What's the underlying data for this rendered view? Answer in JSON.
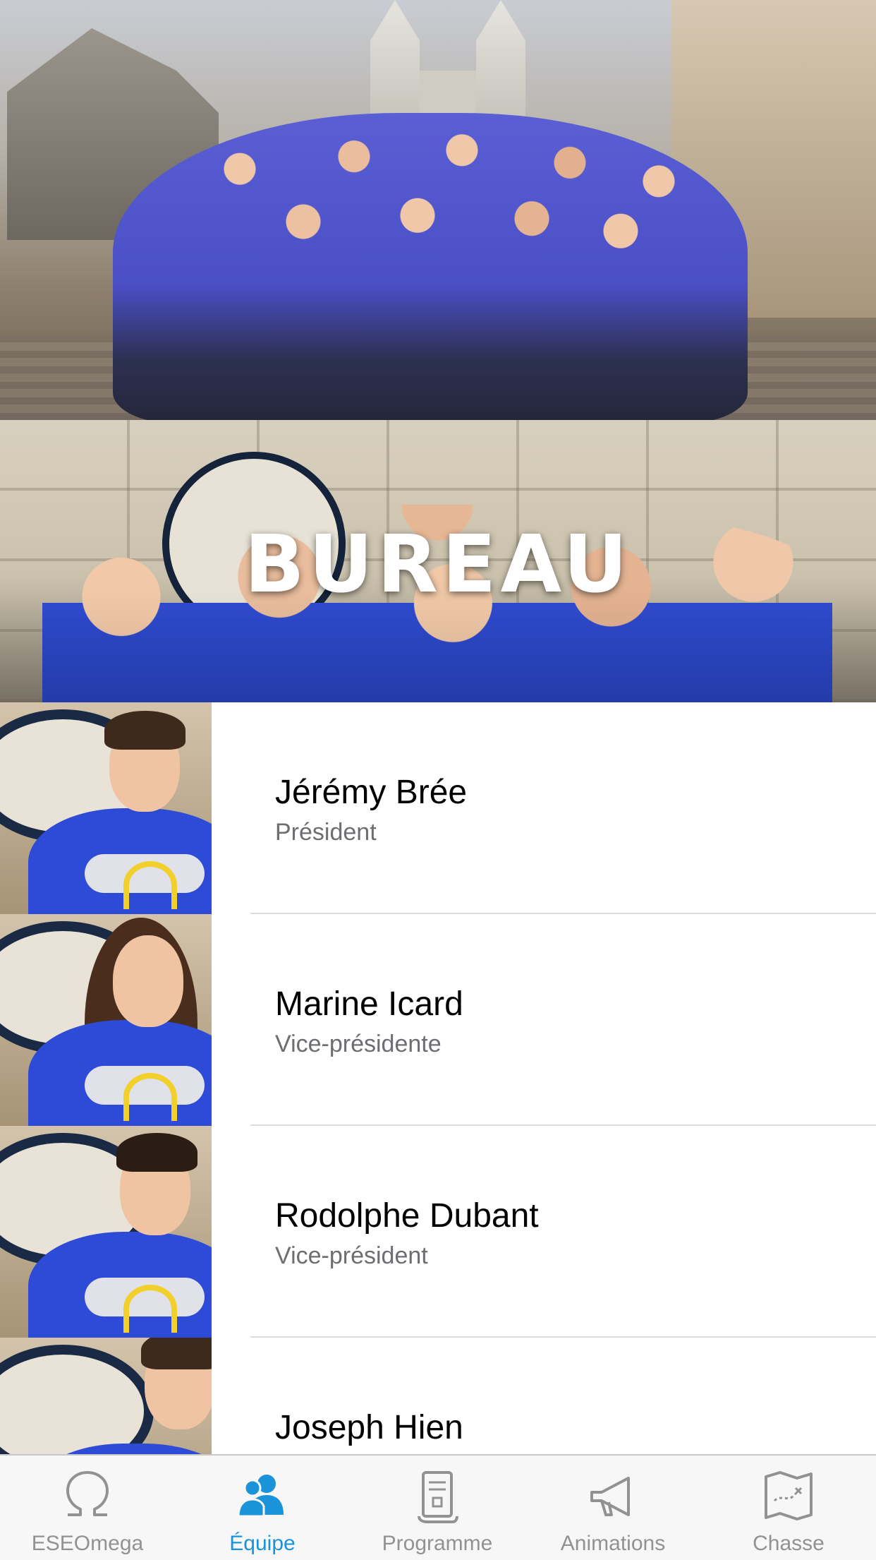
{
  "section": {
    "title": "BUREAU"
  },
  "members": [
    {
      "name": "Jérémy Brée",
      "role": "Président"
    },
    {
      "name": "Marine Icard",
      "role": "Vice-présidente"
    },
    {
      "name": "Rodolphe Dubant",
      "role": "Vice-président"
    },
    {
      "name": "Joseph Hien",
      "role": ""
    }
  ],
  "tabbar": {
    "active_index": 1,
    "active_color": "#1a93d9",
    "inactive_color": "#929292",
    "tabs": [
      {
        "label": "ESEOmega",
        "icon": "omega-icon"
      },
      {
        "label": "Équipe",
        "icon": "team-icon"
      },
      {
        "label": "Programme",
        "icon": "scroll-icon"
      },
      {
        "label": "Animations",
        "icon": "megaphone-icon"
      },
      {
        "label": "Chasse",
        "icon": "treasure-map-icon"
      }
    ]
  }
}
